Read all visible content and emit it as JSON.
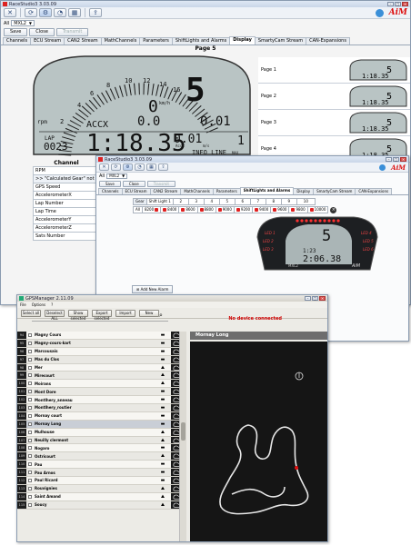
{
  "win1": {
    "title": "RaceStudio3 3.03.09",
    "device_prefix": "All",
    "device": "MXL2",
    "buttons": [
      "Save",
      "Close",
      "Transmit"
    ],
    "tabs": [
      "Channels",
      "ECU Stream",
      "CAN2 Stream",
      "MathChannels",
      "Parameters",
      "ShiftLights and Alarms",
      "Display",
      "SmartyCam Stream",
      "CAN-Expansions"
    ],
    "selected_tab": "Display",
    "page_title": "Page 5",
    "pages": [
      "Page 1",
      "Page 2",
      "Page 3",
      "Page 4"
    ],
    "dash": {
      "gear": "5",
      "rpm_ticks": [
        "2",
        "4",
        "6",
        "8",
        "10",
        "12",
        "14",
        "16"
      ],
      "rpm_label": "rpm",
      "speed": "0",
      "speed_unit": "km/h",
      "field_acc": "ACCX",
      "acc_value": "0.0",
      "best_value": "0.01",
      "lap_label": "LAP",
      "lap_value": "0023",
      "time": "1:18.35",
      "row3_value": "0.01",
      "row3_sub_left": "AccZ",
      "row3_sub_right": "m/s",
      "row3_right": "1",
      "info_line": "INFO LINE",
      "max_label": "MAX"
    },
    "channel_header": "Channel",
    "channels": [
      "RPM",
      ">>  \"Calculated Gear\" not fo",
      "GPS Speed",
      "AccelerometerX",
      "Lap Number",
      "Lap Time",
      "AccelerometerY",
      "AccelerometerZ",
      "Sats Number"
    ]
  },
  "win2": {
    "title": "RaceStudio3 3.03.09",
    "device_prefix": "All",
    "device": "MXL2",
    "buttons": [
      "Save",
      "Close",
      "Transmit"
    ],
    "tabs": [
      "Channels",
      "ECU Stream",
      "CAN2 Stream",
      "MathChannels",
      "Parameters",
      "ShiftLights and Alarms",
      "Display",
      "SmartyCam Stream",
      "CAN-Expansions"
    ],
    "selected_tab": "ShiftLights and Alarms",
    "shift_header": [
      "Gear",
      "Shift Light 1",
      "2",
      "3",
      "4",
      "5",
      "6",
      "7",
      "8",
      "9",
      "10"
    ],
    "shift_row_label": "All",
    "shift_values": [
      "8200",
      "8400",
      "8600",
      "8800",
      "9000",
      "9200",
      "9400",
      "9600",
      "9800",
      "10000"
    ],
    "dash": {
      "led_labels": [
        "LED 1",
        "LED 2",
        "LED 3",
        "LED 4",
        "LED 5",
        "LED 6"
      ],
      "gear": "5",
      "time": "2:06.38",
      "sub1": "1:23",
      "brand": "MXL2",
      "aim": "AiM"
    },
    "add_alarm": "Add New Alarm"
  },
  "win3": {
    "title": "GPSManager 2.11.09",
    "menu": [
      "File",
      "Options",
      "?"
    ],
    "tool_buttons": [
      "Select all",
      "Deselect ALL",
      "Show selected",
      "Export selected",
      "Import",
      "New"
    ],
    "status": "No device connected",
    "selected_track": "Mornay Long",
    "tracks": [
      {
        "idx": "94",
        "name": "Magny Cours",
        "kind": "car"
      },
      {
        "idx": "95",
        "name": "Magny-cours-kart",
        "kind": "kart"
      },
      {
        "idx": "96",
        "name": "Marcousais",
        "kind": "car"
      },
      {
        "idx": "97",
        "name": "Mas du Clos",
        "kind": "car"
      },
      {
        "idx": "98",
        "name": "Mer",
        "kind": "bike"
      },
      {
        "idx": "99",
        "name": "Mirecourt",
        "kind": "bike"
      },
      {
        "idx": "100",
        "name": "Moirans",
        "kind": "bike"
      },
      {
        "idx": "101",
        "name": "Mont Dore",
        "kind": "car"
      },
      {
        "idx": "102",
        "name": "Montlhery_anneau",
        "kind": "car"
      },
      {
        "idx": "103",
        "name": "Montlhery_routier",
        "kind": "car"
      },
      {
        "idx": "104",
        "name": "Mornay court",
        "kind": "car"
      },
      {
        "idx": "105",
        "name": "Mornay Long",
        "kind": "car"
      },
      {
        "idx": "106",
        "name": "Mulhouse",
        "kind": "bike"
      },
      {
        "idx": "107",
        "name": "Neuilly clermont",
        "kind": "bike"
      },
      {
        "idx": "108",
        "name": "Nogaro",
        "kind": "car"
      },
      {
        "idx": "109",
        "name": "Ostricourt",
        "kind": "bike"
      },
      {
        "idx": "110",
        "name": "Pau",
        "kind": "car"
      },
      {
        "idx": "111",
        "name": "Pau Arnos",
        "kind": "car"
      },
      {
        "idx": "112",
        "name": "Paul Ricard",
        "kind": "car"
      },
      {
        "idx": "113",
        "name": "Rouvignies",
        "kind": "bike"
      },
      {
        "idx": "114",
        "name": "Saint Amand",
        "kind": "bike"
      },
      {
        "idx": "115",
        "name": "Soucy",
        "kind": "bike"
      }
    ]
  }
}
